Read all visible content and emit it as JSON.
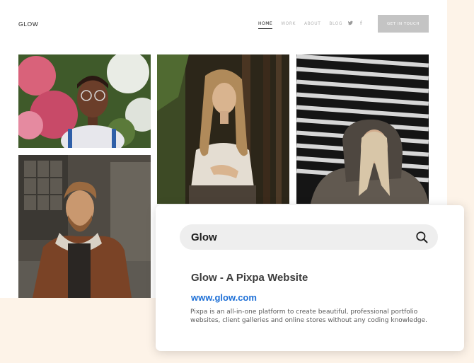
{
  "site": {
    "logo": "GLOW",
    "nav": [
      {
        "label": "HOME",
        "active": true
      },
      {
        "label": "WORK",
        "active": false
      },
      {
        "label": "ABOUT",
        "active": false
      },
      {
        "label": "BLOG",
        "active": false
      }
    ],
    "social": {
      "twitter": "𝕥",
      "facebook": "f"
    },
    "cta_label": "GET IN TOUCH",
    "photos": [
      {
        "name": "portrait-woman-flowers"
      },
      {
        "name": "portrait-woman-forest"
      },
      {
        "name": "portrait-woman-hood"
      },
      {
        "name": "portrait-man-jacket"
      }
    ]
  },
  "search_card": {
    "query": "Glow",
    "icon": "search-icon",
    "result": {
      "title": "Glow - A Pixpa Website",
      "url": "www.glow.com",
      "description": "Pixpa is an all-in-one platform to create beautiful, professional portfolio websites, client galleries and online stores without any coding knowledge."
    }
  },
  "colors": {
    "background": "#fdf3e8",
    "link": "#1d6fd6",
    "cta": "#c4c4c4"
  }
}
